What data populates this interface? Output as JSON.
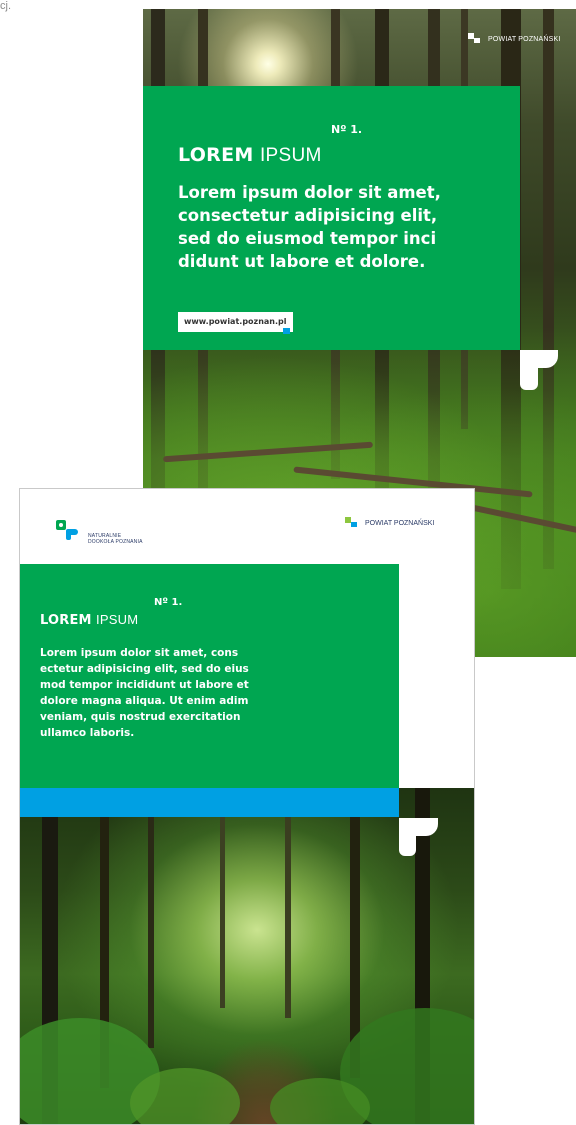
{
  "corner_text": "cj.",
  "back_poster": {
    "brand": "POWIAT POZNAŃSKI",
    "number": "Nº 1.",
    "lorem_bold": "LOREM",
    "lorem_light": "IPSUM",
    "body_lines": [
      "Lorem ipsum dolor sit amet,",
      "consectetur adipisicing elit,",
      "sed  do eiusmod tempor inci",
      "didunt ut labore et dolore."
    ],
    "url": "www.powiat.poznan.pl"
  },
  "front_poster": {
    "logo_line1": "NATURALNIE",
    "logo_line2": "DOOKOŁA POZNANIA",
    "brand": "POWIAT POZNAŃSKI",
    "number": "Nº 1.",
    "lorem_bold": "LOREM",
    "lorem_light": "IPSUM",
    "body_lines": [
      "Lorem ipsum dolor sit amet, cons",
      "ectetur adipisicing elit, sed do eius",
      "mod tempor incididunt ut labore et",
      "dolore magna aliqua. Ut enim adim",
      "veniam, quis nostrud exercitation",
      "ullamco laboris."
    ]
  },
  "colors": {
    "brand_green": "#00a651",
    "brand_blue": "#00a0e3",
    "logo_lime": "#8dc63f"
  }
}
